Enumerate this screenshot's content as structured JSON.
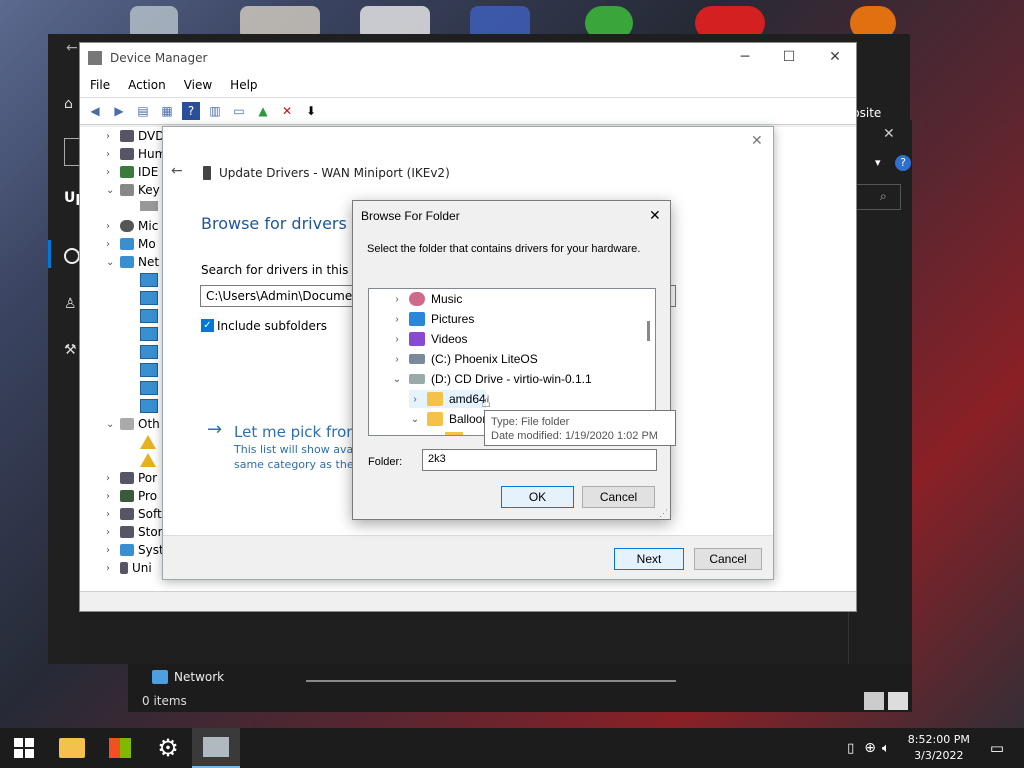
{
  "colors": {
    "accent": "#0078d7",
    "link": "#2e6fb0",
    "wizard_heading": "#1e5799"
  },
  "background_window": {
    "partial_title": "Up",
    "site_text": "bsite"
  },
  "device_manager": {
    "title": "Device Manager",
    "menu": [
      "File",
      "Action",
      "View",
      "Help"
    ],
    "tree": [
      {
        "label": "DVD",
        "expanded": false
      },
      {
        "label": "Hum",
        "expanded": false
      },
      {
        "label": "IDE",
        "expanded": false
      },
      {
        "label": "Key",
        "expanded": true
      },
      {
        "label": "Mic",
        "expanded": false
      },
      {
        "label": "Mo",
        "expanded": false
      },
      {
        "label": "Net",
        "expanded": true
      },
      {
        "label": "Oth",
        "expanded": true
      },
      {
        "label": "Por",
        "expanded": false
      },
      {
        "label": "Pro",
        "expanded": false
      },
      {
        "label": "Soft",
        "expanded": false
      },
      {
        "label": "Stor",
        "expanded": false
      },
      {
        "label": "Syst",
        "expanded": false
      },
      {
        "label": "Uni",
        "expanded": false
      }
    ]
  },
  "wizard": {
    "title": "Update Drivers - WAN Miniport (IKEv2)",
    "heading": "Browse for drivers on",
    "search_label": "Search for drivers in this locat",
    "path_value": "C:\\Users\\Admin\\Document",
    "include_subfolders": "Include subfolders",
    "pick_link": "Let me pick from",
    "pick_desc_1": "This list will show avail",
    "pick_desc_2": "same category as the d",
    "next": "Next",
    "cancel": "Cancel"
  },
  "browse_dialog": {
    "title": "Browse For Folder",
    "instruction": "Select the folder that contains drivers for your hardware.",
    "items": [
      {
        "label": "Music",
        "icon": "music-icon"
      },
      {
        "label": "Pictures",
        "icon": "pictures-icon"
      },
      {
        "label": "Videos",
        "icon": "videos-icon"
      },
      {
        "label": "(C:) Phoenix LiteOS",
        "icon": "drive-icon"
      },
      {
        "label": "(D:) CD Drive - virtio-win-0.1.1",
        "icon": "cd-drive-icon"
      },
      {
        "label": "amd64",
        "icon": "folder-icon"
      },
      {
        "label": "Balloon",
        "icon": "folder-icon"
      }
    ],
    "folder_label": "Folder:",
    "folder_value": "2k3",
    "ok": "OK",
    "cancel": "Cancel"
  },
  "tooltip": {
    "type": "Type: File folder",
    "date": "Date modified: 1/19/2020 1:02 PM"
  },
  "explorer": {
    "network": "Network",
    "items": "0 items"
  },
  "taskbar": {
    "time": "8:52:00 PM",
    "date": "3/3/2022"
  }
}
